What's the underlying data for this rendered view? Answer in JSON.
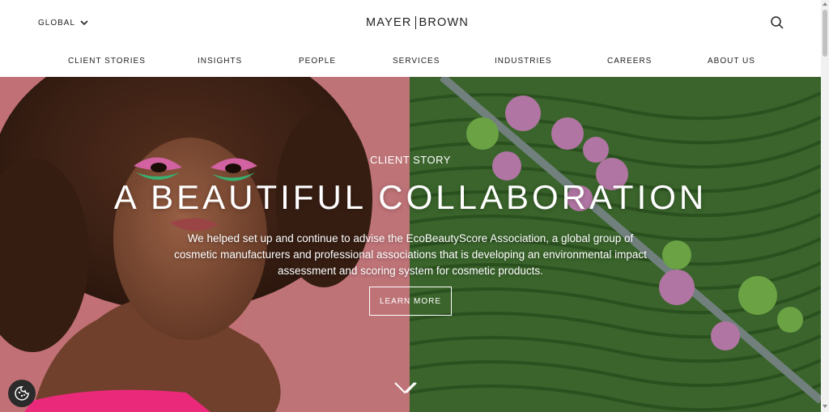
{
  "header": {
    "region_label": "GLOBAL",
    "logo_left": "MAYER",
    "logo_right": "BROWN"
  },
  "nav": {
    "items": [
      {
        "label": "CLIENT STORIES"
      },
      {
        "label": "INSIGHTS"
      },
      {
        "label": "PEOPLE"
      },
      {
        "label": "SERVICES"
      },
      {
        "label": "INDUSTRIES"
      },
      {
        "label": "CAREERS"
      },
      {
        "label": "ABOUT US"
      }
    ]
  },
  "hero": {
    "eyebrow": "CLIENT STORY",
    "headline": "A BEAUTIFUL COLLABORATION",
    "description": "We helped set up and continue to advise the EcoBeautyScore Association, a global group of cosmetic manufacturers and professional associations that is developing an environmental impact assessment and scoring system for cosmetic products.",
    "cta_label": "LEARN MORE"
  },
  "icons": {
    "region": "chevron-down-icon",
    "search": "search-icon",
    "scroll": "double-chevron-down-icon",
    "cookie": "cookie-icon"
  },
  "colors": {
    "text": "#222222",
    "hero_left_bg": "#d27a7f",
    "hero_right_bg": "#3e6b2f",
    "cookie_bg": "#2b2b2b"
  }
}
